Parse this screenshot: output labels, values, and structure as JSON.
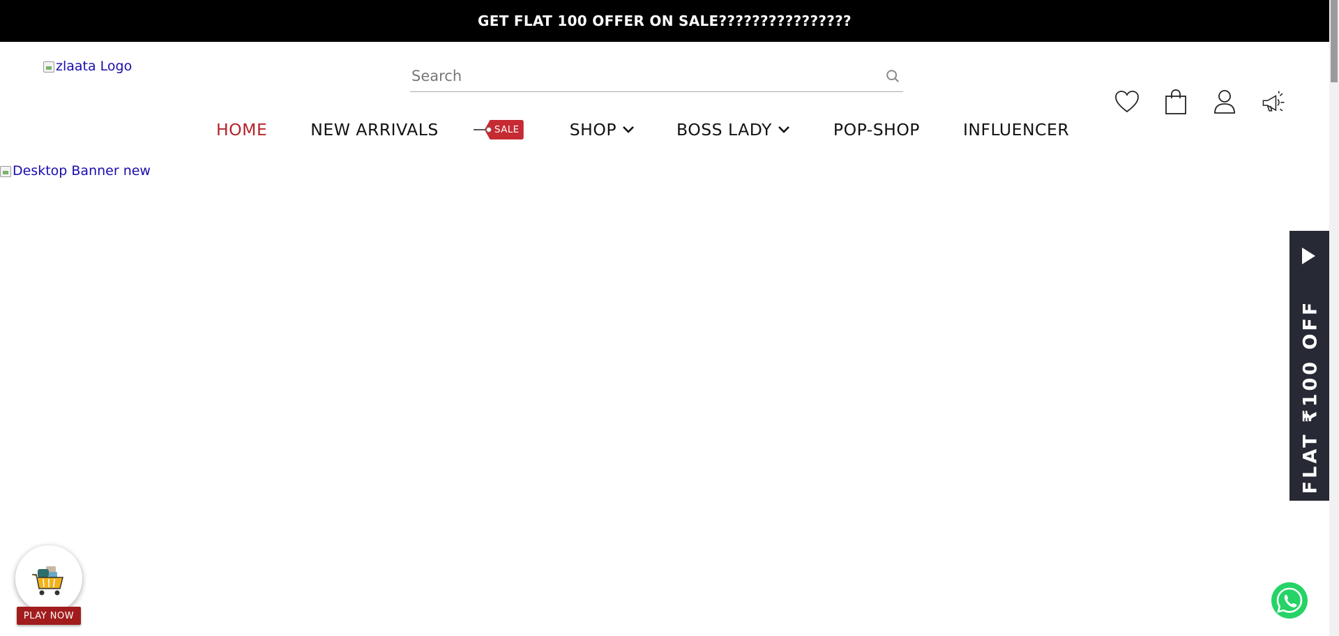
{
  "announcement": {
    "text": "GET FLAT 100 OFFER ON SALE????????????????"
  },
  "header": {
    "logo_alt": "zlaata Logo",
    "search": {
      "placeholder": "Search",
      "value": ""
    },
    "icons": [
      "heart-icon",
      "shopping-bag-icon",
      "user-icon",
      "megaphone-icon"
    ]
  },
  "nav": {
    "items": [
      {
        "label": "HOME",
        "active": true
      },
      {
        "label": "NEW ARRIVALS"
      },
      {
        "label": "SALE",
        "type": "tag"
      },
      {
        "label": "SHOP",
        "dropdown": true
      },
      {
        "label": "BOSS LADY",
        "dropdown": true
      },
      {
        "label": "POP-SHOP"
      },
      {
        "label": "INFLUENCER"
      }
    ]
  },
  "banner": {
    "alt": "Desktop Banner new"
  },
  "side_offer": {
    "text": "FLAT ₹100 OFF"
  },
  "play_widget": {
    "label": "PLAY NOW"
  },
  "colors": {
    "announce_bg": "#000000",
    "accent_red": "#b3242b",
    "sale_tag": "#c62a33",
    "side_offer_bg": "#272934",
    "play_label_bg": "#a11d1d",
    "whatsapp_green": "#25d366",
    "link_blue": "#1a0dab"
  }
}
